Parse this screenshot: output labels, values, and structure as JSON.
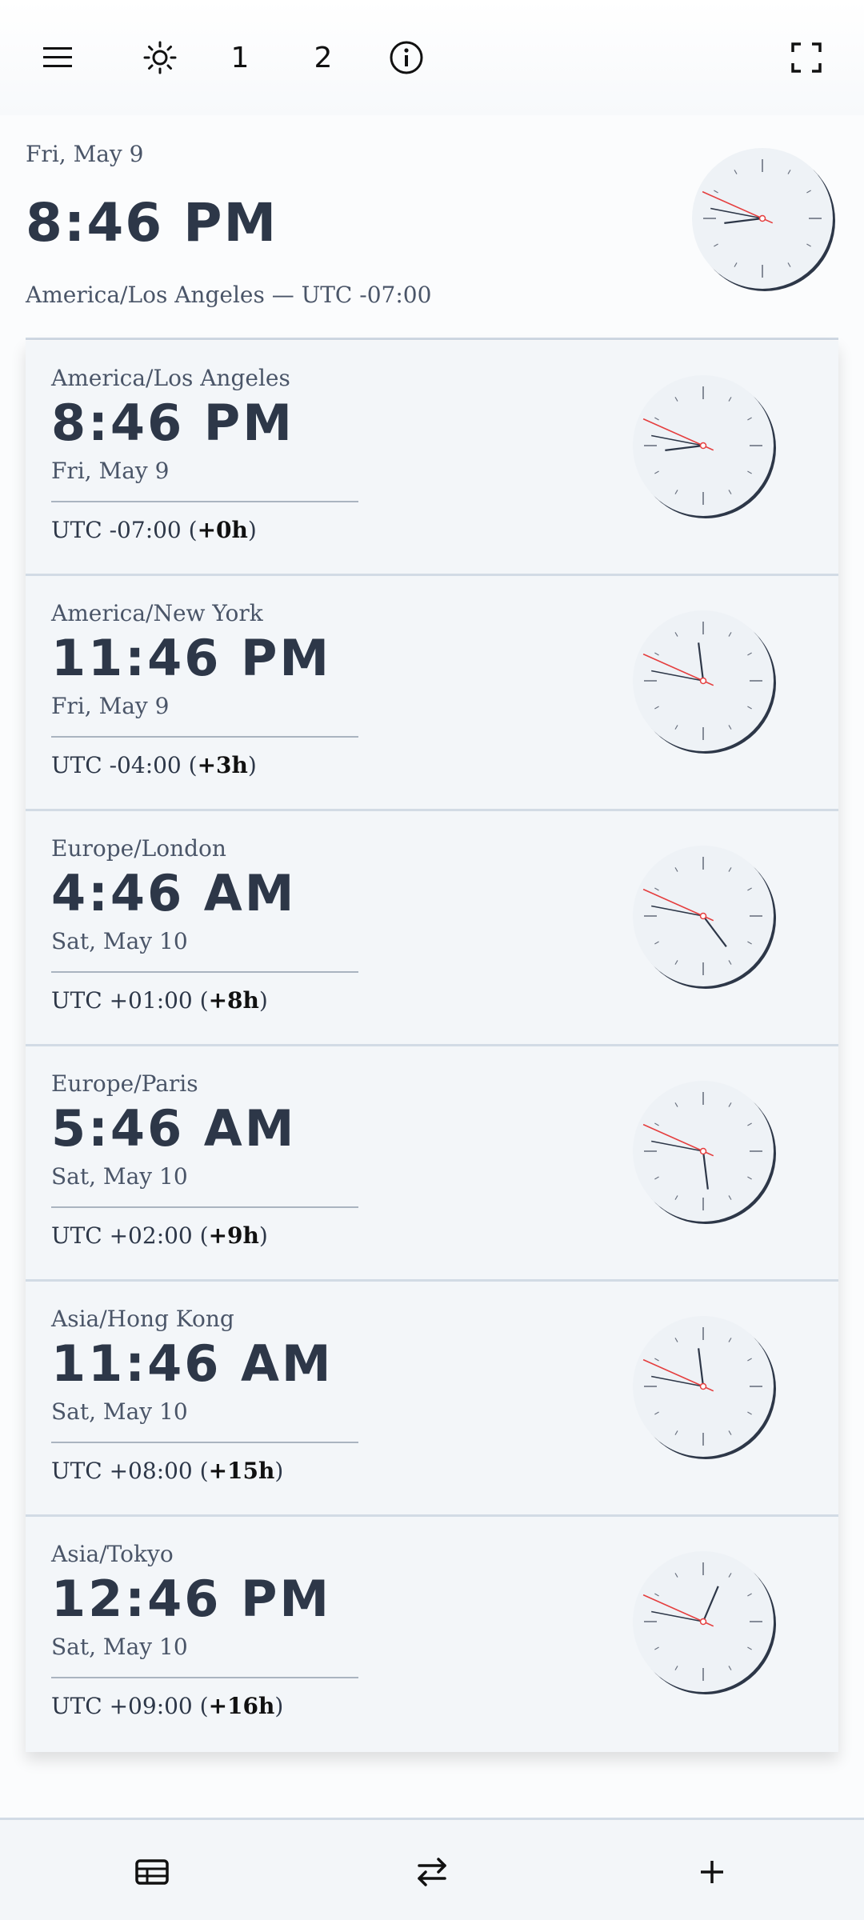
{
  "toolbar": {
    "menu_icon": "menu-icon",
    "theme_icon": "brightness-icon",
    "layout_one_label": "1",
    "layout_two_label": "2",
    "info_icon": "info-icon",
    "fullscreen_icon": "fullscreen-icon"
  },
  "header": {
    "date": "Fri, May 9",
    "time": "8:46 PM",
    "zone_line": "America/Los Angeles — UTC -07:00",
    "clock": {
      "hour": 20,
      "minute": 46,
      "second": 49
    }
  },
  "clocks": [
    {
      "zone": "America/Los Angeles",
      "time": "8:46 PM",
      "date": "Fri, May 9",
      "utc": "UTC -07:00 (",
      "diff": "+0h",
      "close": ")",
      "hour": 20,
      "minute": 46,
      "second": 49
    },
    {
      "zone": "America/New York",
      "time": "11:46 PM",
      "date": "Fri, May 9",
      "utc": "UTC -04:00 (",
      "diff": "+3h",
      "close": ")",
      "hour": 23,
      "minute": 46,
      "second": 49
    },
    {
      "zone": "Europe/London",
      "time": "4:46 AM",
      "date": "Sat, May 10",
      "utc": "UTC +01:00 (",
      "diff": "+8h",
      "close": ")",
      "hour": 4,
      "minute": 46,
      "second": 49
    },
    {
      "zone": "Europe/Paris",
      "time": "5:46 AM",
      "date": "Sat, May 10",
      "utc": "UTC +02:00 (",
      "diff": "+9h",
      "close": ")",
      "hour": 5,
      "minute": 46,
      "second": 49
    },
    {
      "zone": "Asia/Hong Kong",
      "time": "11:46 AM",
      "date": "Sat, May 10",
      "utc": "UTC +08:00 (",
      "diff": "+15h",
      "close": ")",
      "hour": 11,
      "minute": 46,
      "second": 49
    },
    {
      "zone": "Asia/Tokyo",
      "time": "12:46 PM",
      "date": "Sat, May 10",
      "utc": "UTC +09:00 (",
      "diff": "+16h",
      "close": ")",
      "hour": 12,
      "minute": 46,
      "second": 49
    }
  ],
  "bottom_nav": {
    "table_icon": "table-icon",
    "swap_icon": "swap-icon",
    "add_icon": "plus-icon"
  },
  "colors": {
    "text": "#2d3748",
    "second_hand": "#e53e3e",
    "card_bg": "#f3f6f9"
  }
}
